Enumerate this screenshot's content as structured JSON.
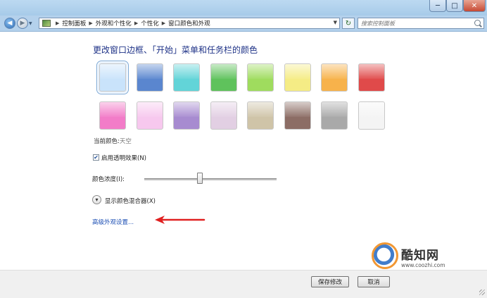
{
  "window": {
    "minimize": "─",
    "maximize": "□",
    "close": "✕"
  },
  "nav": {
    "back": "◀",
    "forward": "▶",
    "history": "▼",
    "refresh": "↻"
  },
  "breadcrumb": [
    "控制面板",
    "外观和个性化",
    "个性化",
    "窗口颜色和外观"
  ],
  "search": {
    "placeholder": "搜索控制面板"
  },
  "heading": "更改窗口边框、「开始」菜单和任务栏的颜色",
  "swatches": [
    {
      "color": "#c9e3fb",
      "selected": true
    },
    {
      "color": "#5a86cf"
    },
    {
      "color": "#62d4d8"
    },
    {
      "color": "#5fc25c"
    },
    {
      "color": "#9fdc5e"
    },
    {
      "color": "#f5ec85"
    },
    {
      "color": "#f7b24b"
    },
    {
      "color": "#e04a4a"
    },
    {
      "color": "#f27cc8"
    },
    {
      "color": "#f7c8ee"
    },
    {
      "color": "#a78bd0"
    },
    {
      "color": "#e2cfe3"
    },
    {
      "color": "#cfc4a8"
    },
    {
      "color": "#8c6d65"
    },
    {
      "color": "#a9a9a9"
    },
    {
      "color": "#f4f4f4"
    }
  ],
  "current_color": {
    "label": "当前颜色:",
    "value": "天空"
  },
  "transparency": {
    "label": "启用透明效果(N)",
    "checked": true
  },
  "intensity": {
    "label": "颜色浓度(I):",
    "value_fraction": 0.42
  },
  "mixer": {
    "label": "显示颜色混合器(X)"
  },
  "advanced_link": "高级外观设置...",
  "watermark": {
    "title": "酷知网",
    "url": "www.coozhi.com"
  },
  "buttons": {
    "save": "保存修改",
    "cancel": "取消"
  },
  "accent_colors": {
    "link": "#1e50b4",
    "heading": "#1e3287",
    "arrow": "#e02020"
  }
}
